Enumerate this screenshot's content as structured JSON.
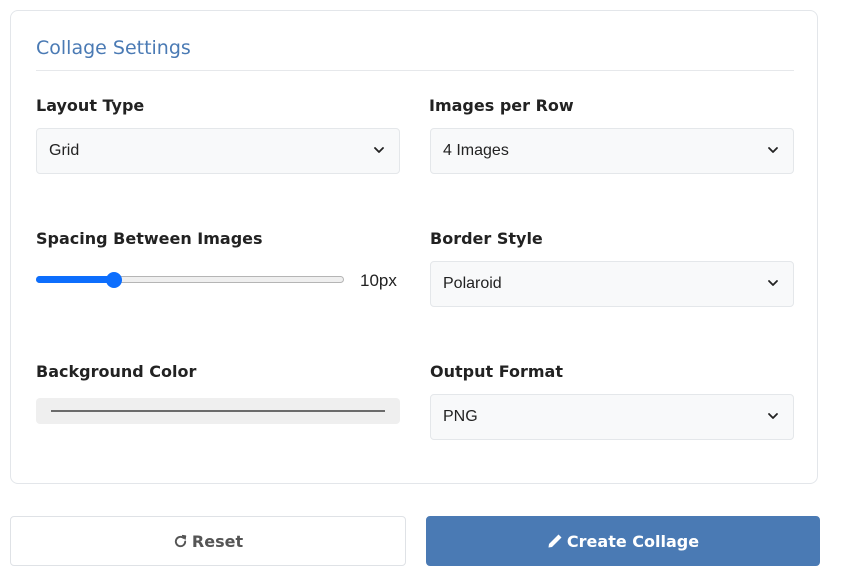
{
  "section": {
    "title": "Collage Settings"
  },
  "layout_type": {
    "label": "Layout Type",
    "value": "Grid"
  },
  "images_per_row": {
    "label": "Images per Row",
    "value": "4 Images"
  },
  "spacing": {
    "label": "Spacing Between Images",
    "value_text": "10px",
    "fraction": 0.24
  },
  "border_style": {
    "label": "Border Style",
    "value": "Polaroid"
  },
  "background_color": {
    "label": "Background Color",
    "color": "#6b6b6b"
  },
  "output_format": {
    "label": "Output Format",
    "value": "PNG"
  },
  "actions": {
    "reset_label": "Reset",
    "reset_icon": "redo-icon",
    "create_label": "Create Collage",
    "create_icon": "pencil-icon"
  },
  "colors": {
    "accent": "#4a7ab4",
    "slider": "#0d6efd"
  }
}
